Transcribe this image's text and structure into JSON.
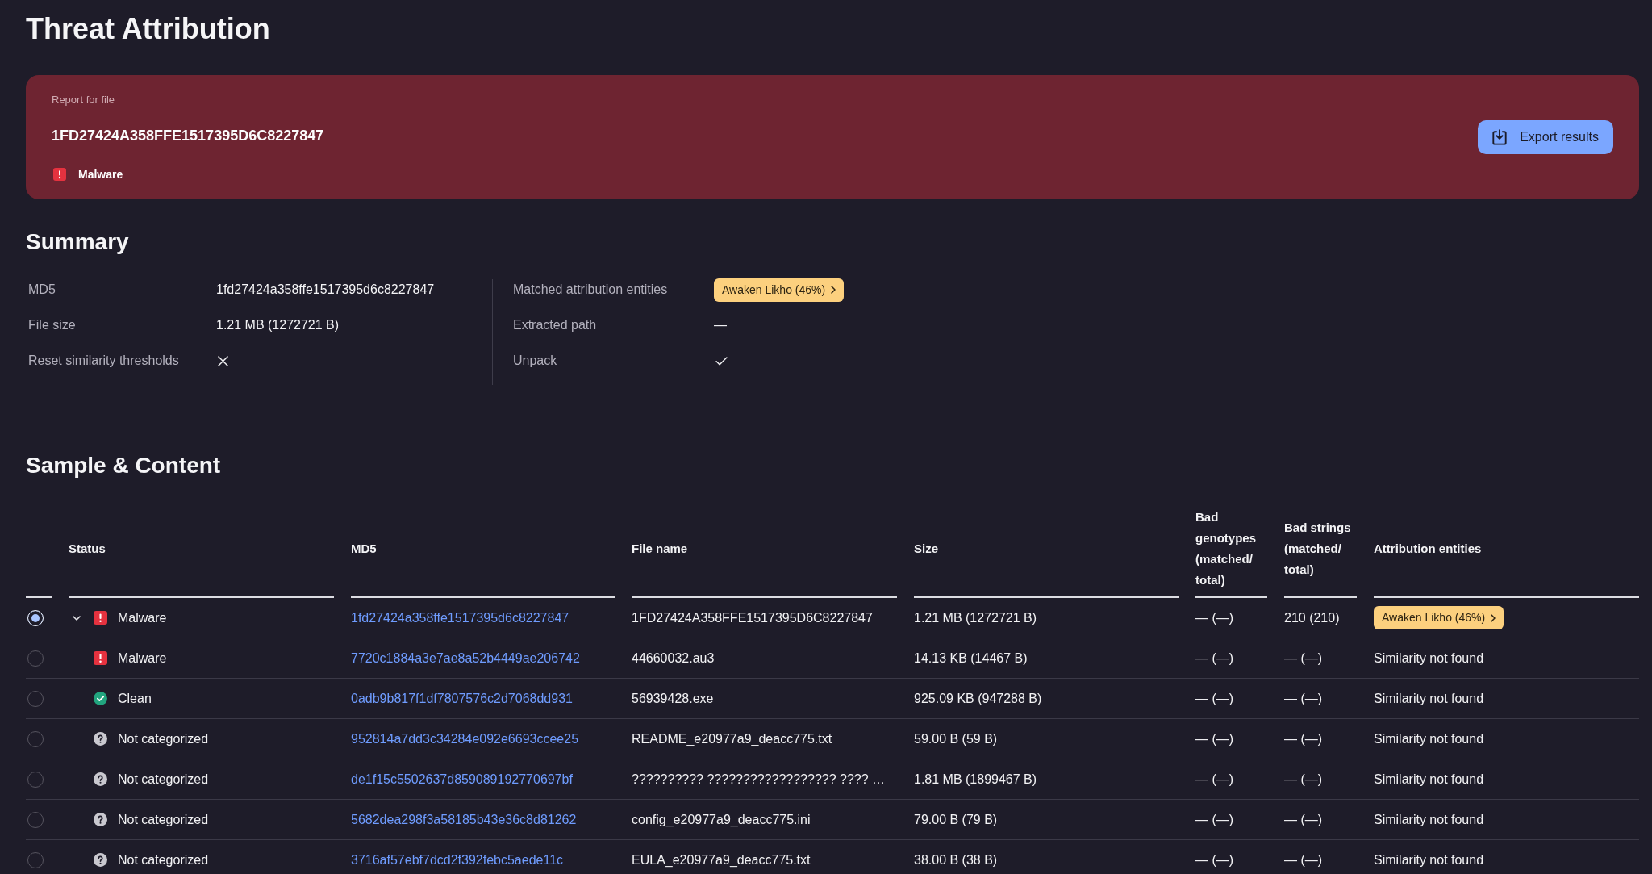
{
  "page": {
    "title": "Threat Attribution"
  },
  "report": {
    "caption": "Report for file",
    "file_hash": "1FD27424A358FFE1517395D6C8227847",
    "verdict": {
      "kind": "malware",
      "label": "Malware"
    },
    "export_button": "Export results"
  },
  "summary": {
    "title": "Summary",
    "left": [
      {
        "kind": "text",
        "label": "MD5",
        "value": "1fd27424a358ffe1517395d6c8227847"
      },
      {
        "kind": "text",
        "label": "File size",
        "value": "1.21 MB (1272721 B)"
      },
      {
        "kind": "flag",
        "label": "Reset similarity thresholds",
        "on": false
      }
    ],
    "right": [
      {
        "kind": "badges",
        "label": "Matched attribution entities",
        "badges": [
          "Awaken Likho (46%)"
        ]
      },
      {
        "kind": "text",
        "label": "Extracted path",
        "value": "—"
      },
      {
        "kind": "flag",
        "label": "Unpack",
        "on": true
      }
    ]
  },
  "sample_content": {
    "title": "Sample & Content",
    "columns": [
      "Status",
      "MD5",
      "File name",
      "Size",
      "Bad genotypes (matched/ total)",
      "Bad strings (matched/ total)",
      "Attribution entities"
    ],
    "rows": [
      {
        "selected": true,
        "expanded": true,
        "status": {
          "kind": "malware",
          "label": "Malware"
        },
        "md5": "1fd27424a358ffe1517395d6c8227847",
        "file_name": "1FD27424A358FFE1517395D6C8227847",
        "size": "1.21 MB (1272721 B)",
        "bad_genotypes": "— (—)",
        "bad_strings": "210 (210)",
        "attribution": {
          "kind": "badge",
          "text": "Awaken Likho (46%)"
        },
        "children": [
          {
            "selected": false,
            "status": {
              "kind": "malware",
              "label": "Malware"
            },
            "md5": "7720c1884a3e7ae8a52b4449ae206742",
            "file_name": "44660032.au3",
            "size": "14.13 KB (14467 B)",
            "bad_genotypes": "— (—)",
            "bad_strings": "— (—)",
            "attribution": {
              "kind": "text",
              "text": "Similarity not found"
            }
          },
          {
            "selected": false,
            "status": {
              "kind": "clean",
              "label": "Clean"
            },
            "md5": "0adb9b817f1df7807576c2d7068dd931",
            "file_name": "56939428.exe",
            "size": "925.09 KB (947288 B)",
            "bad_genotypes": "— (—)",
            "bad_strings": "— (—)",
            "attribution": {
              "kind": "text",
              "text": "Similarity not found"
            }
          },
          {
            "selected": false,
            "status": {
              "kind": "uncategorized",
              "label": "Not categorized"
            },
            "md5": "952814a7dd3c34284e092e6693ccee25",
            "file_name": "README_e20977a9_deacc775.txt",
            "size": "59.00 B (59 B)",
            "bad_genotypes": "— (—)",
            "bad_strings": "— (—)",
            "attribution": {
              "kind": "text",
              "text": "Similarity not found"
            }
          },
          {
            "selected": false,
            "status": {
              "kind": "uncategorized",
              "label": "Not categorized"
            },
            "md5": "de1f15c5502637d859089192770697bf",
            "file_name": "?????????? ?????????????????? ???? …",
            "size": "1.81 MB (1899467 B)",
            "bad_genotypes": "— (—)",
            "bad_strings": "— (—)",
            "attribution": {
              "kind": "text",
              "text": "Similarity not found"
            }
          },
          {
            "selected": false,
            "status": {
              "kind": "uncategorized",
              "label": "Not categorized"
            },
            "md5": "5682dea298f3a58185b43e36c8d81262",
            "file_name": "config_e20977a9_deacc775.ini",
            "size": "79.00 B (79 B)",
            "bad_genotypes": "— (—)",
            "bad_strings": "— (—)",
            "attribution": {
              "kind": "text",
              "text": "Similarity not found"
            }
          },
          {
            "selected": false,
            "status": {
              "kind": "uncategorized",
              "label": "Not categorized"
            },
            "md5": "3716af57ebf7dcd2f392febc5aede11c",
            "file_name": "EULA_e20977a9_deacc775.txt",
            "size": "38.00 B (38 B)",
            "bad_genotypes": "— (—)",
            "bad_strings": "— (—)",
            "attribution": {
              "kind": "text",
              "text": "Similarity not found"
            }
          }
        ]
      }
    ]
  }
}
